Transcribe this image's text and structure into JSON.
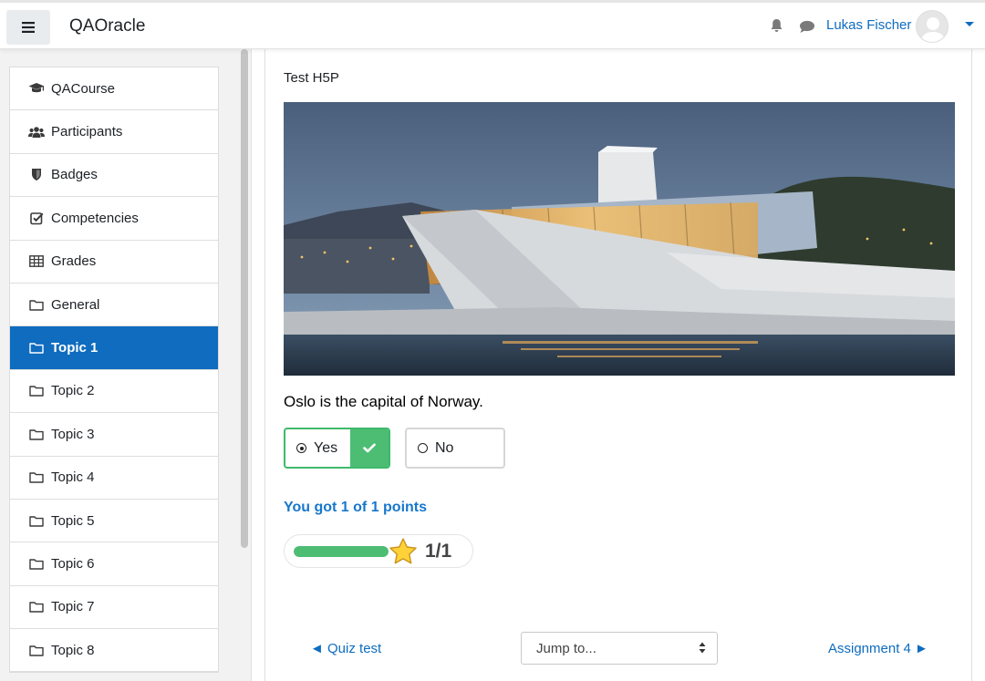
{
  "navbar": {
    "site_name": "QAOracle",
    "user_name": "Lukas Fischer"
  },
  "drawer": {
    "items": [
      {
        "label": "QACourse",
        "icon": "graduation-cap-icon"
      },
      {
        "label": "Participants",
        "icon": "users-icon"
      },
      {
        "label": "Badges",
        "icon": "shield-icon"
      },
      {
        "label": "Competencies",
        "icon": "check-square-icon"
      },
      {
        "label": "Grades",
        "icon": "table-icon"
      },
      {
        "label": "General",
        "icon": "folder-icon"
      },
      {
        "label": "Topic 1",
        "icon": "folder-icon",
        "active": true
      },
      {
        "label": "Topic 2",
        "icon": "folder-icon"
      },
      {
        "label": "Topic 3",
        "icon": "folder-icon"
      },
      {
        "label": "Topic 4",
        "icon": "folder-icon"
      },
      {
        "label": "Topic 5",
        "icon": "folder-icon"
      },
      {
        "label": "Topic 6",
        "icon": "folder-icon"
      },
      {
        "label": "Topic 7",
        "icon": "folder-icon"
      },
      {
        "label": "Topic 8",
        "icon": "folder-icon"
      }
    ]
  },
  "main": {
    "title": "Test H5P",
    "question": "Oslo is the capital of Norway.",
    "options": {
      "yes": "Yes",
      "no": "No"
    },
    "selected": "Yes",
    "result_text": "You got 1 of 1 points",
    "score": "1/1",
    "score_fraction": 1.0
  },
  "footer_nav": {
    "prev_label": "◄ Quiz test",
    "jump_placeholder": "Jump to...",
    "next_label": "Assignment 4 ►"
  },
  "colors": {
    "accent": "#0f6cbf",
    "success": "#4dbd74"
  }
}
